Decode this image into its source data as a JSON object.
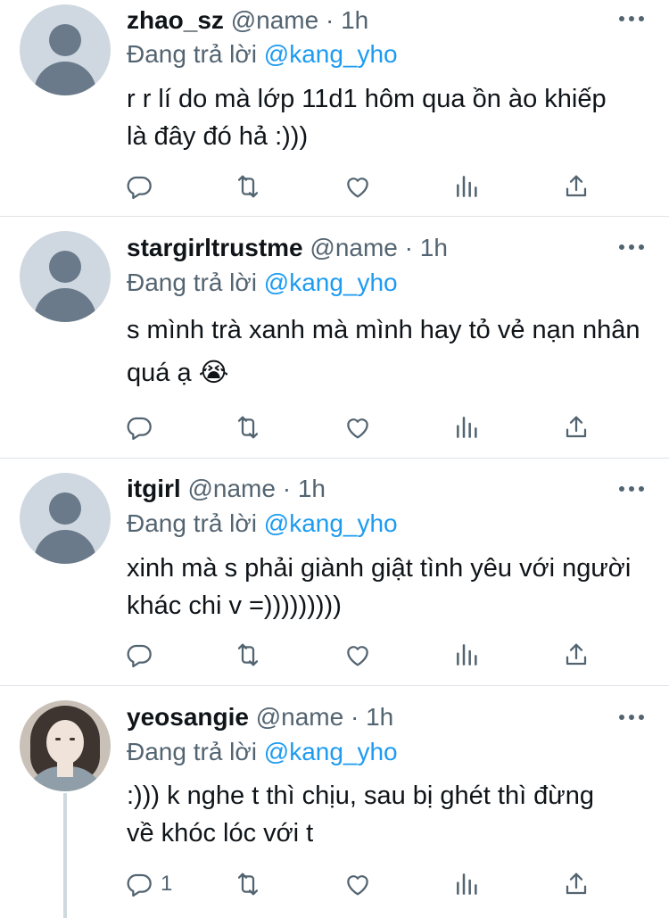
{
  "tweets": [
    {
      "username": "zhao_sz",
      "handle": "@name",
      "dot": "·",
      "time": "1h",
      "reply_prefix": "Đang trả lời",
      "reply_to": "@kang_yho",
      "text": "r r lí do mà lớp 11d1 hôm qua ồn ào khiếp là đây đó hả :)))",
      "reply_count": ""
    },
    {
      "username": "stargirltrustme",
      "handle": "@name",
      "dot": "·",
      "time": "1h",
      "reply_prefix": "Đang trả lời",
      "reply_to": "@kang_yho",
      "text": "s mình trà xanh mà mình hay tỏ vẻ nạn nhân quá ạ 😭",
      "reply_count": ""
    },
    {
      "username": "itgirl",
      "handle": "@name",
      "dot": "·",
      "time": "1h",
      "reply_prefix": "Đang trả lời",
      "reply_to": "@kang_yho",
      "text": "xinh mà s phải giành giật tình yêu với người khác chi v =)))))))))",
      "reply_count": ""
    },
    {
      "username": "yeosangie",
      "handle": "@name",
      "dot": "·",
      "time": "1h",
      "reply_prefix": "Đang trả lời",
      "reply_to": "@kang_yho",
      "text": ":))) k nghe t thì chịu, sau bị ghét thì đừng về khóc lóc với t",
      "reply_count": "1"
    }
  ],
  "icons": {
    "reply": "reply-icon",
    "retweet": "retweet-icon",
    "like": "like-icon",
    "views": "views-icon",
    "share": "share-icon",
    "more": "more-icon"
  },
  "colors": {
    "text": "#0f1419",
    "secondary": "#536471",
    "accent": "#1d9bf0",
    "divider": "#dfe4e8"
  }
}
